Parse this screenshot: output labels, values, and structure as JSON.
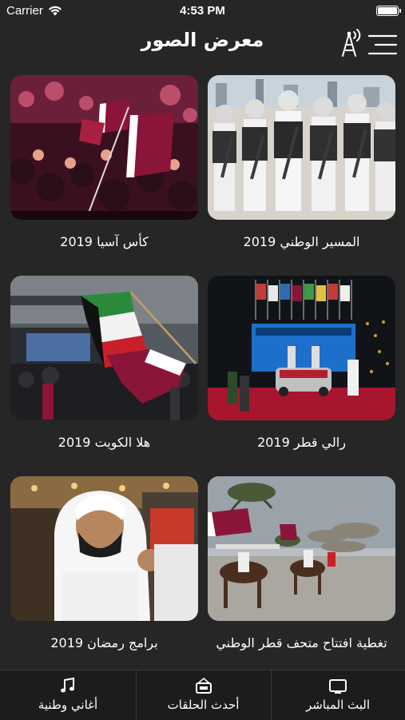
{
  "status_bar": {
    "carrier": "Carrier",
    "time": "4:53 PM"
  },
  "header": {
    "title": "معرض الصور"
  },
  "gallery": {
    "items": [
      {
        "caption": "المسير الوطني 2019"
      },
      {
        "caption": "كأس آسيا 2019"
      },
      {
        "caption": "رالي قطر 2019"
      },
      {
        "caption": "هلا الكويت 2019"
      },
      {
        "caption": "تغطية افتتاح متحف قطر الوطني"
      },
      {
        "caption": "برامج رمضان 2019"
      }
    ]
  },
  "tabs": [
    {
      "label": "البث المباشر",
      "icon": "tv-icon"
    },
    {
      "label": "أحدث الحلقات",
      "icon": "episodes-icon"
    },
    {
      "label": "أغاني وطنية",
      "icon": "music-note-icon"
    }
  ],
  "colors": {
    "background": "#262626",
    "tab_bar": "#1c1c1c",
    "qatar_maroon": "#8a1538"
  }
}
